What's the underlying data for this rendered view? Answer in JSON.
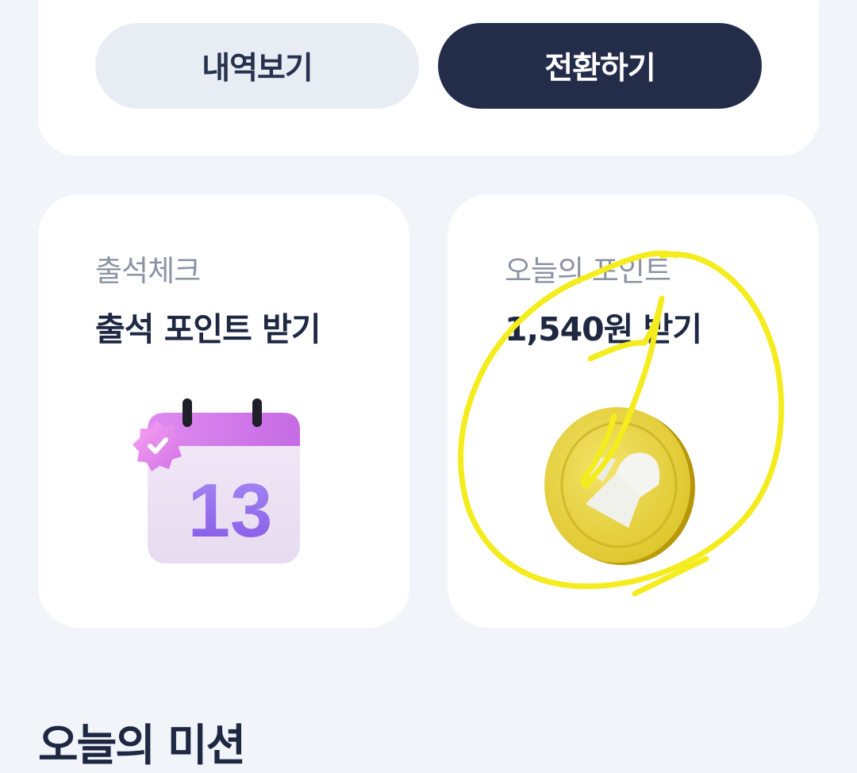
{
  "top_card": {
    "history_button_label": "내역보기",
    "convert_button_label": "전환하기"
  },
  "attendance_card": {
    "subtitle": "출석체크",
    "title": "출석 포인트 받기",
    "calendar_day": "13",
    "icon": "calendar-check-icon"
  },
  "points_card": {
    "subtitle": "오늘의 포인트",
    "title": "1,540원 받기",
    "icon": "coin-icon"
  },
  "section": {
    "title": "오늘의 미션"
  },
  "colors": {
    "background": "#f1f5fa",
    "card": "#ffffff",
    "primary_dark": "#232c49",
    "secondary_button": "#e8edf4",
    "text_dark": "#1f2842",
    "text_muted": "#8b93a2",
    "annotation": "#f4ec1c"
  }
}
